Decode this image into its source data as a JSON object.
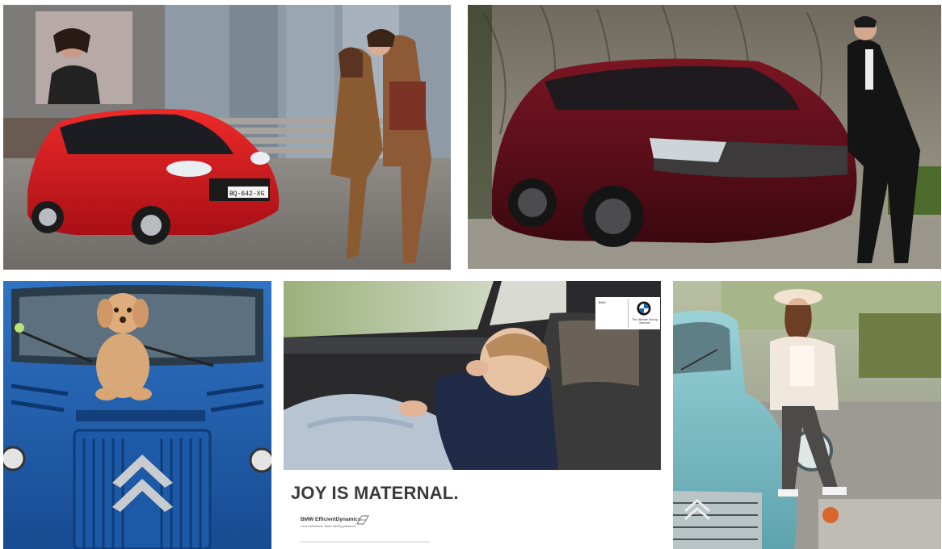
{
  "collage": {
    "tiles": [
      {
        "subject": "Red Citroën C1 parked outside a building with a billboard, couple walking beside it"
      },
      {
        "subject": "Dark red DS Wild Rubis concept SUV with a man in a suit"
      },
      {
        "subject": "Curly-haired dog sitting on the hood of a blue Citroën HY van"
      },
      {
        "subject": "Toddler asleep in a car seat under a blue blanket (BMW ad)"
      },
      {
        "subject": "Woman in a hat and blazer posing beside a light blue Citroën 2CV"
      }
    ]
  },
  "citroen_c1": {
    "plate": "BQ-642-XG"
  },
  "bmw_ad": {
    "headline": "JOY IS MATERNAL.",
    "efficient_dynamics": "BMW EfficientDynamics",
    "tagline": "Less emissions. More driving pleasure.",
    "panel_left_title": "BMW",
    "panel_right": "The Ultimate Driving Machine"
  },
  "colors": {
    "c1_red": "#d3141c",
    "ds_burgundy": "#5b0f18",
    "hy_blue": "#1f5fb0",
    "twocv_blue": "#7ec0c8",
    "bmw_blue": "#1c66b5"
  }
}
